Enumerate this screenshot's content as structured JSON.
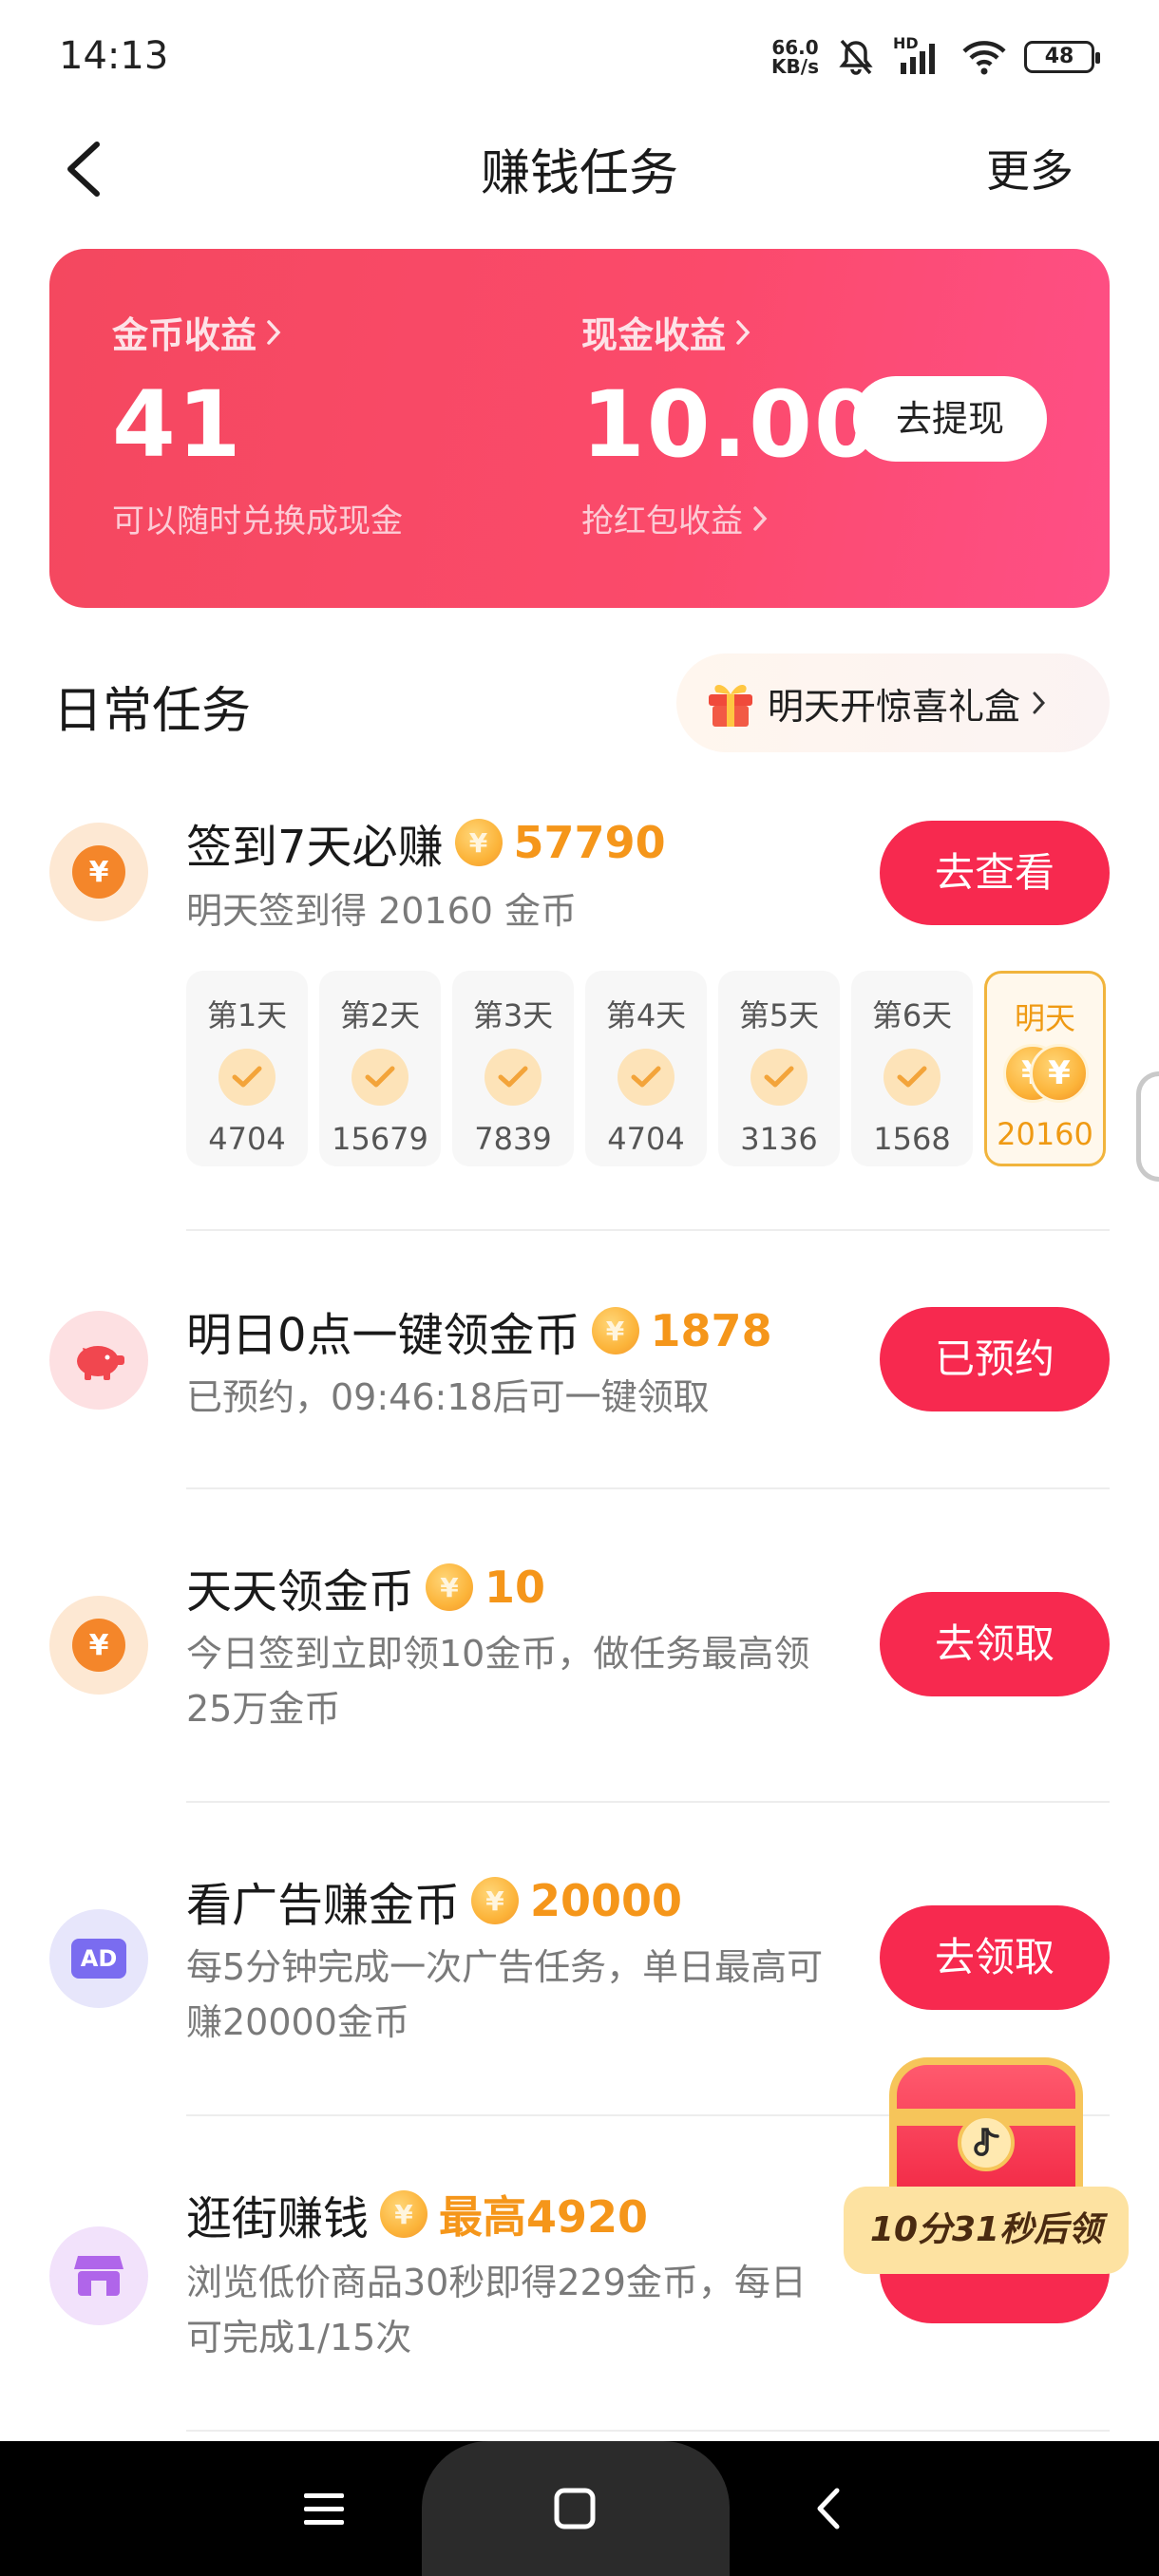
{
  "status_bar": {
    "time": "14:13",
    "net_speed_value": "66.0",
    "net_speed_unit": "KB/s",
    "signal_tag": "HD",
    "battery": "48"
  },
  "header": {
    "title": "赚钱任务",
    "more": "更多"
  },
  "earnings": {
    "coin_label": "金币收益",
    "coin_value": "41",
    "coin_sub": "可以随时兑换成现金",
    "cash_label": "现金收益",
    "cash_value": "10.00",
    "cash_sub": "抢红包收益",
    "withdraw_label": "去提现"
  },
  "daily": {
    "section_title": "日常任务",
    "gift_label": "明天开惊喜礼盒"
  },
  "tasks": [
    {
      "title": "签到7天必赚",
      "reward": "57790",
      "desc": "明天签到得 20160 金币",
      "action": "去查看",
      "days": [
        {
          "label": "第1天",
          "value": "4704"
        },
        {
          "label": "第2天",
          "value": "15679"
        },
        {
          "label": "第3天",
          "value": "7839"
        },
        {
          "label": "第4天",
          "value": "4704"
        },
        {
          "label": "第5天",
          "value": "3136"
        },
        {
          "label": "第6天",
          "value": "1568"
        },
        {
          "label": "明天",
          "value": "20160"
        }
      ]
    },
    {
      "title": "明日0点一键领金币",
      "reward": "1878",
      "desc": "已预约，09:46:18后可一键领取",
      "action": "已预约"
    },
    {
      "title": "天天领金币",
      "reward": "10",
      "desc": "今日签到立即领10金币，做任务最高领25万金币",
      "action": "去领取"
    },
    {
      "title": "看广告赚金币",
      "reward": "20000",
      "desc": "每5分钟完成一次广告任务，单日最高可赚20000金币",
      "action": "去领取"
    },
    {
      "title": "逛街赚钱",
      "reward": "最高4920",
      "desc": "浏览低价商品30秒即得229金币，每日可完成1/15次",
      "action": ""
    }
  ],
  "coin_symbol": "¥",
  "ad_badge": "AD",
  "treasure": {
    "timer": "10分31秒后领"
  },
  "colors": {
    "accent_red": "#f7294f",
    "card_gradient_start": "#f4485f",
    "card_gradient_end": "#fe4f86",
    "reward_orange": "#f5961a"
  }
}
